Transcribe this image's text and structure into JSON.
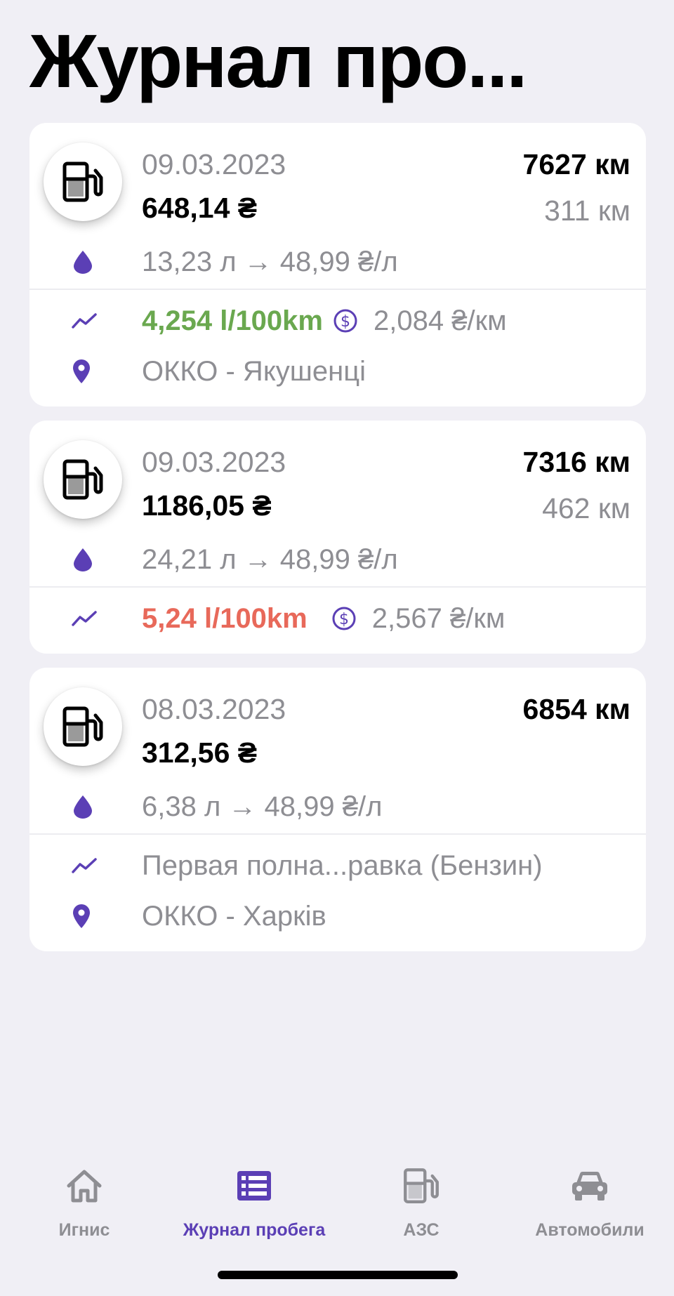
{
  "header": {
    "title": "Журнал про..."
  },
  "entries": [
    {
      "date": "09.03.2023",
      "amount": "648,14 ₴",
      "odometer": "7627 км",
      "distance": "311 км",
      "fuel": "13,23 л → 48,99 ₴/л",
      "consumption": "4,254 l/100km",
      "consumption_status": "good",
      "cost_per_km": "2,084 ₴/км",
      "station": "ОККО - Якушенці"
    },
    {
      "date": "09.03.2023",
      "amount": "1186,05 ₴",
      "odometer": "7316 км",
      "distance": "462 км",
      "fuel": "24,21 л → 48,99 ₴/л",
      "consumption": "5,24 l/100km",
      "consumption_status": "bad",
      "cost_per_km": "2,567 ₴/км"
    },
    {
      "date": "08.03.2023",
      "amount": "312,56 ₴",
      "odometer": "6854 км",
      "fuel": "6,38 л → 48,99 ₴/л",
      "note": "Первая полна...равка (Бензин)",
      "station": "ОККО - Харків"
    }
  ],
  "tabbar": {
    "items": [
      {
        "label": "Игнис",
        "icon": "house-icon",
        "active": false
      },
      {
        "label": "Журнал пробега",
        "icon": "list-icon",
        "active": true
      },
      {
        "label": "АЗС",
        "icon": "fuel-pump-icon",
        "active": false
      },
      {
        "label": "Автомобили",
        "icon": "car-icon",
        "active": false
      }
    ]
  },
  "colors": {
    "accent": "#5b3fb5",
    "good": "#6aa84f",
    "bad": "#e8695a",
    "secondary_text": "#8e8e93",
    "background": "#f0eff5"
  }
}
